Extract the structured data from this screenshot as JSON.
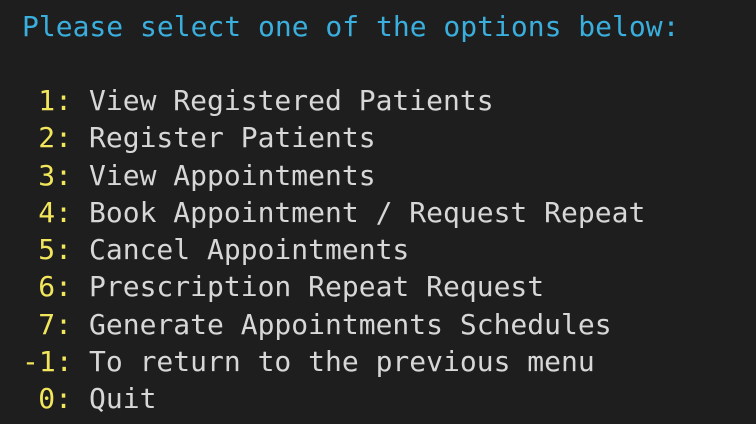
{
  "prompt": "Please select one of the options below:",
  "menu": {
    "items": [
      {
        "number": "1:",
        "label": "View Registered Patients"
      },
      {
        "number": "2:",
        "label": "Register Patients"
      },
      {
        "number": "3:",
        "label": "View Appointments"
      },
      {
        "number": "4:",
        "label": "Book Appointment / Request Repeat"
      },
      {
        "number": "5:",
        "label": "Cancel Appointments"
      },
      {
        "number": "6:",
        "label": "Prescription Repeat Request"
      },
      {
        "number": "7:",
        "label": "Generate Appointments Schedules"
      },
      {
        "number": "-1:",
        "label": "To return to the previous menu"
      },
      {
        "number": "0:",
        "label": "Quit"
      }
    ]
  },
  "colors": {
    "background": "#1e1e1e",
    "prompt": "#3aaedc",
    "number": "#f2e65c",
    "text": "#d7d7d7"
  }
}
